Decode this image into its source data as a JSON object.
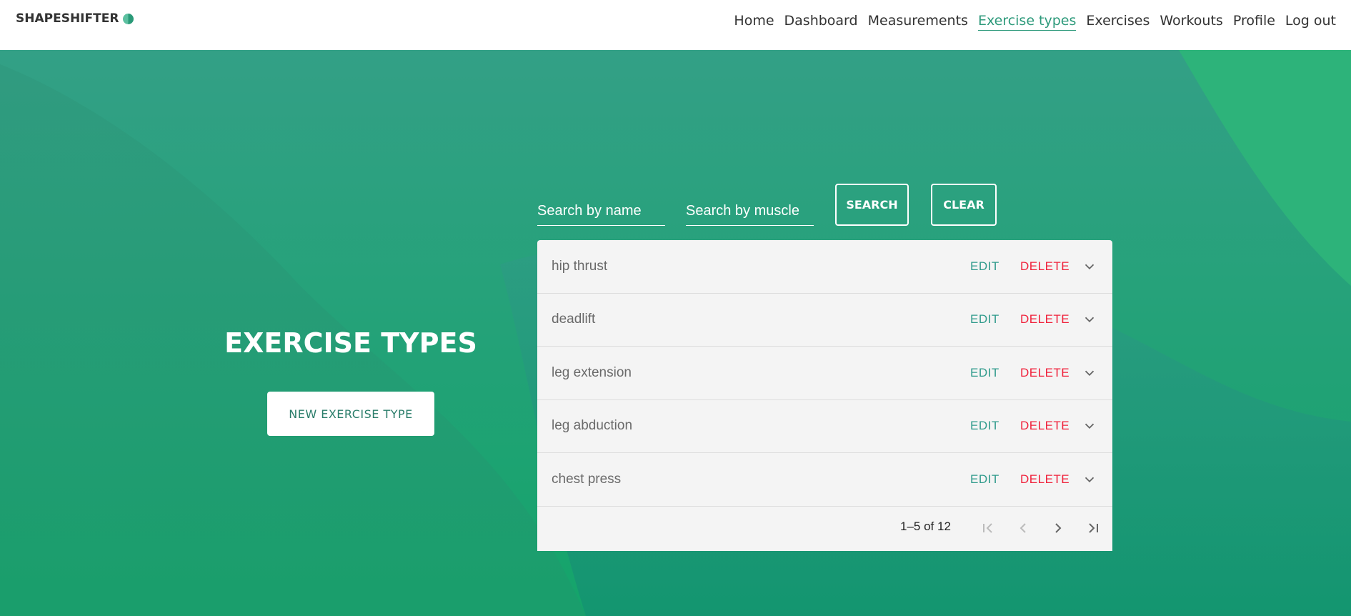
{
  "nav": {
    "logo": "SHAPESHIFTER",
    "items": [
      {
        "label": "Home",
        "active": false
      },
      {
        "label": "Dashboard",
        "active": false
      },
      {
        "label": "Measurements",
        "active": false
      },
      {
        "label": "Exercise types",
        "active": true
      },
      {
        "label": "Exercises",
        "active": false
      },
      {
        "label": "Workouts",
        "active": false
      },
      {
        "label": "Profile",
        "active": false
      },
      {
        "label": "Log out",
        "active": false
      }
    ]
  },
  "hero": {
    "title": "EXERCISE TYPES",
    "new_button": "NEW EXERCISE TYPE"
  },
  "search": {
    "name_placeholder": "Search by name",
    "muscle_placeholder": "Search by muscle",
    "search_label": "SEARCH",
    "clear_label": "CLEAR"
  },
  "list": {
    "edit_label": "EDIT",
    "delete_label": "DELETE",
    "rows": [
      {
        "name": "hip thrust"
      },
      {
        "name": "deadlift"
      },
      {
        "name": "leg extension"
      },
      {
        "name": "leg abduction"
      },
      {
        "name": "chest press"
      }
    ]
  },
  "pagination": {
    "range": "1–5 of 12"
  },
  "colors": {
    "accent": "#2e9a7b",
    "delete": "#f0203a",
    "bg": "#1f9a78"
  }
}
